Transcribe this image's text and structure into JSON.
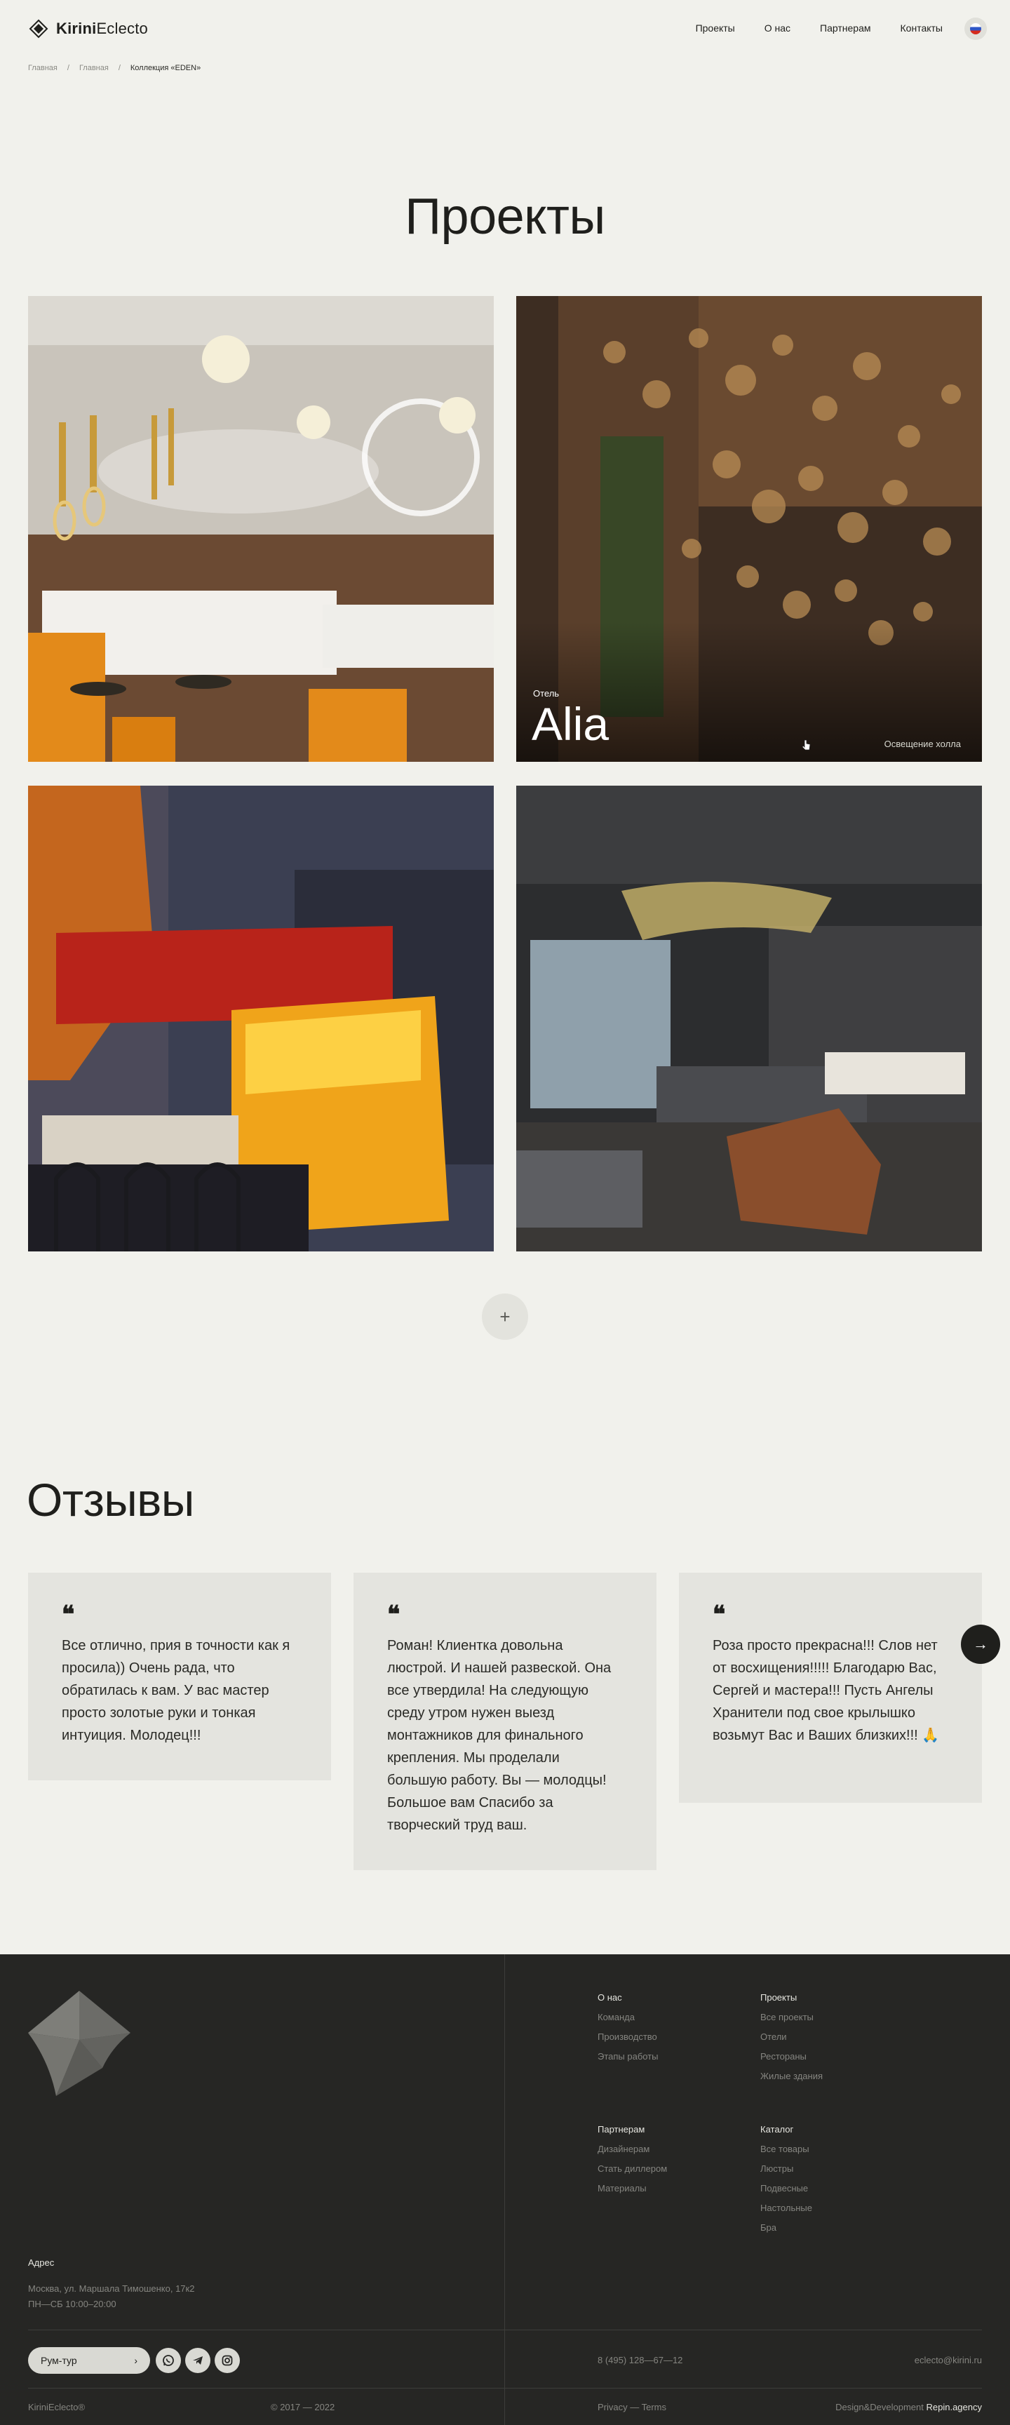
{
  "header": {
    "logo_bold": "Kirini",
    "logo_light": "Eclecto",
    "nav": [
      "Проекты",
      "О нас",
      "Партнерам",
      "Контакты"
    ],
    "lang_icon": "flag-ru-icon"
  },
  "breadcrumb": [
    "Главная",
    "Главная",
    "Коллекция «EDEN»"
  ],
  "projects": {
    "title": "Проекты",
    "featured": {
      "category": "Отель",
      "name": "Alia",
      "subtitle": "Освещение холла"
    },
    "more_label": "+"
  },
  "reviews": {
    "title": "Отзывы",
    "quote_mark": "❝",
    "items": [
      "Все отлично, прия в точности как я просила)) Очень рада, что обратилась к вам. У вас мастер просто золотые руки и тонкая интуиция. Молодец!!!",
      "Роман! Клиентка довольна люстрой. И нашей развеской. Она все утвердила! На следующую среду утром нужен выезд монтажников для финального крепления. Мы проделали большую работу. Вы — молодцы! Большое вам Спасибо за творческий труд ваш.",
      "Роза просто прекрасна!!! Слов нет от восхищения!!!!! Благодарю Вас, Сергей и мастера!!! Пусть Ангелы Хранители под свое крылышко возьмут Вас и Ваших близких!!! 🙏"
    ],
    "next_icon": "→"
  },
  "footer": {
    "about": {
      "title": "О нас",
      "items": [
        "Команда",
        "Производство",
        "Этапы работы"
      ]
    },
    "projects": {
      "title": "Проекты",
      "items": [
        "Все проекты",
        "Отели",
        "Рестораны",
        "Жилые здания"
      ]
    },
    "partners": {
      "title": "Партнерам",
      "items": [
        "Дизайнерам",
        "Стать диллером",
        "Материалы"
      ]
    },
    "catalog": {
      "title": "Каталог",
      "items": [
        "Все товары",
        "Люстры",
        "Подвесные",
        "Настольные",
        "Бра"
      ]
    },
    "address_title": "Адрес",
    "address_line1": "Москва, ул. Маршала Тимошенко, 17к2",
    "address_line2": "ПН—СБ 10:00–20:00",
    "tour_label": "Рум-тур",
    "tour_arrow": "›",
    "phone": "8 (495) 128—67—12",
    "email": "eclecto@kirini.ru",
    "copyright_brand": "KiriniEclecto®",
    "years": "© 2017 — 2022",
    "privacy": "Privacy — Terms",
    "credits_prefix": "Design&Development",
    "credits_agency": "Repin.agency"
  }
}
